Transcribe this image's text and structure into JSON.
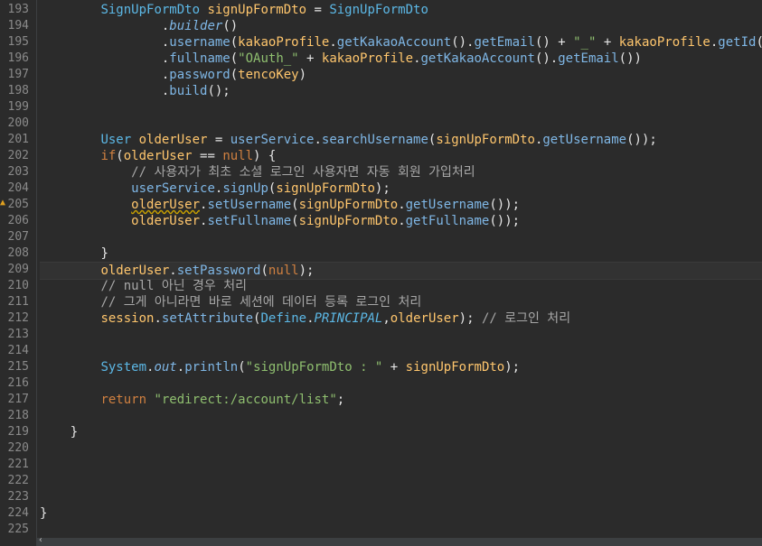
{
  "editor": {
    "lines": [
      {
        "n": "193",
        "t": [
          [
            "sp",
            "        "
          ],
          [
            "ty",
            "SignUpFormDto"
          ],
          [
            "sp",
            " "
          ],
          [
            "vr",
            "signUpFormDto"
          ],
          [
            "pl",
            " = "
          ],
          [
            "ty",
            "SignUpFormDto"
          ]
        ]
      },
      {
        "n": "194",
        "t": [
          [
            "sp",
            "                "
          ],
          [
            "pl",
            "."
          ],
          [
            "it",
            "builder"
          ],
          [
            "pl",
            "()"
          ]
        ]
      },
      {
        "n": "195",
        "t": [
          [
            "sp",
            "                "
          ],
          [
            "pl",
            "."
          ],
          [
            "fn",
            "username"
          ],
          [
            "pl",
            "("
          ],
          [
            "vr",
            "kakaoProfile"
          ],
          [
            "pl",
            "."
          ],
          [
            "fn",
            "getKakaoAccount"
          ],
          [
            "pl",
            "()."
          ],
          [
            "fn",
            "getEmail"
          ],
          [
            "pl",
            "() + "
          ],
          [
            "st",
            "\"_\""
          ],
          [
            "pl",
            " + "
          ],
          [
            "vr",
            "kakaoProfile"
          ],
          [
            "pl",
            "."
          ],
          [
            "fn",
            "getId"
          ],
          [
            "pl",
            "())"
          ]
        ]
      },
      {
        "n": "196",
        "t": [
          [
            "sp",
            "                "
          ],
          [
            "pl",
            "."
          ],
          [
            "fn",
            "fullname"
          ],
          [
            "pl",
            "("
          ],
          [
            "st",
            "\"OAuth_\""
          ],
          [
            "pl",
            " + "
          ],
          [
            "vr",
            "kakaoProfile"
          ],
          [
            "pl",
            "."
          ],
          [
            "fn",
            "getKakaoAccount"
          ],
          [
            "pl",
            "()."
          ],
          [
            "fn",
            "getEmail"
          ],
          [
            "pl",
            "())"
          ]
        ]
      },
      {
        "n": "197",
        "t": [
          [
            "sp",
            "                "
          ],
          [
            "pl",
            "."
          ],
          [
            "fn",
            "password"
          ],
          [
            "pl",
            "("
          ],
          [
            "vr",
            "tencoKey"
          ],
          [
            "pl",
            ")"
          ]
        ]
      },
      {
        "n": "198",
        "t": [
          [
            "sp",
            "                "
          ],
          [
            "pl",
            "."
          ],
          [
            "fn",
            "build"
          ],
          [
            "pl",
            "();"
          ]
        ]
      },
      {
        "n": "199",
        "t": []
      },
      {
        "n": "200",
        "t": []
      },
      {
        "n": "201",
        "t": [
          [
            "sp",
            "        "
          ],
          [
            "ty",
            "User"
          ],
          [
            "sp",
            " "
          ],
          [
            "vr",
            "olderUser"
          ],
          [
            "pl",
            " = "
          ],
          [
            "fn",
            "userService"
          ],
          [
            "pl",
            "."
          ],
          [
            "fn",
            "searchUsername"
          ],
          [
            "pl",
            "("
          ],
          [
            "vr",
            "signUpFormDto"
          ],
          [
            "pl",
            "."
          ],
          [
            "fn",
            "getUsername"
          ],
          [
            "pl",
            "());"
          ]
        ]
      },
      {
        "n": "202",
        "t": [
          [
            "sp",
            "        "
          ],
          [
            "kw",
            "if"
          ],
          [
            "pl",
            "("
          ],
          [
            "vr",
            "olderUser"
          ],
          [
            "pl",
            " == "
          ],
          [
            "kw",
            "null"
          ],
          [
            "pl",
            ") {"
          ]
        ]
      },
      {
        "n": "203",
        "t": [
          [
            "sp",
            "            "
          ],
          [
            "cm",
            "// 사용자가 최초 소셜 로그인 사용자면 자동 회원 가입처리"
          ]
        ]
      },
      {
        "n": "204",
        "t": [
          [
            "sp",
            "            "
          ],
          [
            "fn",
            "userService"
          ],
          [
            "pl",
            "."
          ],
          [
            "fn",
            "signUp"
          ],
          [
            "pl",
            "("
          ],
          [
            "vr",
            "signUpFormDto"
          ],
          [
            "pl",
            ");"
          ]
        ]
      },
      {
        "n": "205",
        "t": [
          [
            "sp",
            "            "
          ],
          [
            "vrw",
            "olderUser"
          ],
          [
            "pl",
            "."
          ],
          [
            "fn",
            "setUsername"
          ],
          [
            "pl",
            "("
          ],
          [
            "vr",
            "signUpFormDto"
          ],
          [
            "pl",
            "."
          ],
          [
            "fn",
            "getUsername"
          ],
          [
            "pl",
            "());"
          ]
        ]
      },
      {
        "n": "206",
        "t": [
          [
            "sp",
            "            "
          ],
          [
            "vr",
            "olderUser"
          ],
          [
            "pl",
            "."
          ],
          [
            "fn",
            "setFullname"
          ],
          [
            "pl",
            "("
          ],
          [
            "vr",
            "signUpFormDto"
          ],
          [
            "pl",
            "."
          ],
          [
            "fn",
            "getFullname"
          ],
          [
            "pl",
            "());"
          ]
        ]
      },
      {
        "n": "207",
        "t": []
      },
      {
        "n": "208",
        "t": [
          [
            "sp",
            "        "
          ],
          [
            "pl",
            "}"
          ]
        ]
      },
      {
        "n": "209",
        "t": [
          [
            "sp",
            "        "
          ],
          [
            "vr",
            "olderUser"
          ],
          [
            "pl",
            "."
          ],
          [
            "fn",
            "setPassword"
          ],
          [
            "pl",
            "("
          ],
          [
            "kw",
            "null"
          ],
          [
            "pl",
            ");"
          ]
        ],
        "current": true
      },
      {
        "n": "210",
        "t": [
          [
            "sp",
            "        "
          ],
          [
            "cm",
            "// null 아닌 경우 처리"
          ]
        ]
      },
      {
        "n": "211",
        "t": [
          [
            "sp",
            "        "
          ],
          [
            "cm",
            "// 그게 아니라면 바로 세션에 데이터 등록 로그인 처리"
          ]
        ]
      },
      {
        "n": "212",
        "t": [
          [
            "sp",
            "        "
          ],
          [
            "vr",
            "session"
          ],
          [
            "pl",
            "."
          ],
          [
            "fn",
            "setAttribute"
          ],
          [
            "pl",
            "("
          ],
          [
            "ty",
            "Define"
          ],
          [
            "pl",
            "."
          ],
          [
            "cs",
            "PRINCIPAL"
          ],
          [
            "pl",
            ","
          ],
          [
            "vr",
            "olderUser"
          ],
          [
            "pl",
            "); "
          ],
          [
            "cm",
            "// 로그인 처리"
          ]
        ]
      },
      {
        "n": "213",
        "t": []
      },
      {
        "n": "214",
        "t": []
      },
      {
        "n": "215",
        "t": [
          [
            "sp",
            "        "
          ],
          [
            "ty",
            "System"
          ],
          [
            "pl",
            "."
          ],
          [
            "it",
            "out"
          ],
          [
            "pl",
            "."
          ],
          [
            "fn",
            "println"
          ],
          [
            "pl",
            "("
          ],
          [
            "st",
            "\"signUpFormDto : \""
          ],
          [
            "pl",
            " + "
          ],
          [
            "vr",
            "signUpFormDto"
          ],
          [
            "pl",
            ");"
          ]
        ]
      },
      {
        "n": "216",
        "t": []
      },
      {
        "n": "217",
        "t": [
          [
            "sp",
            "        "
          ],
          [
            "kw",
            "return"
          ],
          [
            "pl",
            " "
          ],
          [
            "st",
            "\"redirect:/account/list\""
          ],
          [
            "pl",
            ";"
          ]
        ]
      },
      {
        "n": "218",
        "t": []
      },
      {
        "n": "219",
        "t": [
          [
            "sp",
            "    "
          ],
          [
            "pl",
            "}"
          ]
        ]
      },
      {
        "n": "220",
        "t": []
      },
      {
        "n": "221",
        "t": []
      },
      {
        "n": "222",
        "t": []
      },
      {
        "n": "223",
        "t": []
      },
      {
        "n": "224",
        "t": [
          [
            "pl",
            "}"
          ]
        ]
      },
      {
        "n": "225",
        "t": []
      }
    ]
  },
  "icons": {
    "warning_marker": "warning-icon",
    "scroll_left": "chevron-left-icon"
  },
  "colors": {
    "background": "#2b2b2b",
    "type": "#5cb8e6",
    "variable": "#ffc66d",
    "string": "#8fbf6f",
    "keyword": "#d08040",
    "comment": "#a7a7a7"
  }
}
